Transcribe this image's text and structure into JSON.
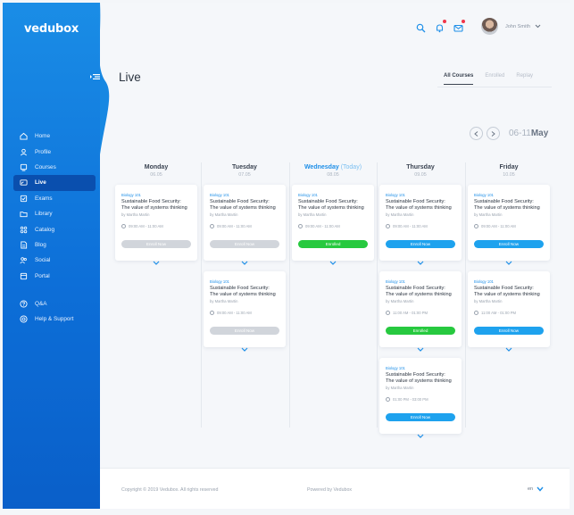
{
  "app": {
    "brand": "vedubox"
  },
  "sidebar": {
    "items": [
      {
        "label": "Home",
        "icon": "home-icon"
      },
      {
        "label": "Profile",
        "icon": "profile-icon"
      },
      {
        "label": "Courses",
        "icon": "courses-icon"
      },
      {
        "label": "Live",
        "icon": "live-icon",
        "active": true
      },
      {
        "label": "Exams",
        "icon": "exams-icon"
      },
      {
        "label": "Library",
        "icon": "library-icon"
      },
      {
        "label": "Catalog",
        "icon": "catalog-icon"
      },
      {
        "label": "Blog",
        "icon": "blog-icon"
      },
      {
        "label": "Social",
        "icon": "social-icon"
      },
      {
        "label": "Portal",
        "icon": "portal-icon"
      }
    ],
    "secondary": [
      {
        "label": "Q&A",
        "icon": "question-icon"
      },
      {
        "label": "Help & Support",
        "icon": "help-icon"
      }
    ]
  },
  "header": {
    "title": "Live",
    "user_name": "John Smith",
    "tabs": [
      "All Courses",
      "Enrolled",
      "Replay"
    ],
    "active_tab": "All Courses"
  },
  "week": {
    "range": "06-11",
    "month": "May"
  },
  "days": [
    {
      "name": "Monday",
      "date": "06.05",
      "today_label": ""
    },
    {
      "name": "Tuesday",
      "date": "07.05",
      "today_label": ""
    },
    {
      "name": "Wednesday",
      "date": "08.05",
      "today_label": "(Today)"
    },
    {
      "name": "Thursday",
      "date": "09.05",
      "today_label": ""
    },
    {
      "name": "Friday",
      "date": "10.05",
      "today_label": ""
    }
  ],
  "cards": [
    {
      "day": 0,
      "slot": 0,
      "tag": "Biology 101",
      "title_line1": "Sustainable Food Security:",
      "title_line2": "The value of systems thinking",
      "author": "by Martha Martin",
      "time": "09:00 AM - 11:00 AM",
      "button": "Enroll Now",
      "button_style": "gray"
    },
    {
      "day": 1,
      "slot": 0,
      "tag": "Biology 101",
      "title_line1": "Sustainable Food Security:",
      "title_line2": "The value of systems thinking",
      "author": "by Martha Martin",
      "time": "09:00 AM - 11:00 AM",
      "button": "Enroll Now",
      "button_style": "gray"
    },
    {
      "day": 1,
      "slot": 1,
      "tag": "Biology 101",
      "title_line1": "Sustainable Food Security:",
      "title_line2": "The value of systems thinking",
      "author": "by Martha Martin",
      "time": "09:00 AM - 11:00 AM",
      "button": "Enroll Now",
      "button_style": "gray"
    },
    {
      "day": 2,
      "slot": 0,
      "tag": "Biology 101",
      "title_line1": "Sustainable Food Security:",
      "title_line2": "The value of systems thinking",
      "author": "by Martha Martin",
      "time": "09:00 AM - 11:00 AM",
      "button": "Enrolled",
      "button_style": "green"
    },
    {
      "day": 3,
      "slot": 0,
      "tag": "Biology 101",
      "title_line1": "Sustainable Food Security:",
      "title_line2": "The value of systems thinking",
      "author": "by Martha Martin",
      "time": "09:00 AM - 11:00 AM",
      "button": "Enroll Now",
      "button_style": "blue"
    },
    {
      "day": 3,
      "slot": 1,
      "tag": "Biology 101",
      "title_line1": "Sustainable Food Security:",
      "title_line2": "The value of systems thinking",
      "author": "by Martha Martin",
      "time": "11:00 AM - 01:00 PM",
      "button": "Enrolled",
      "button_style": "green"
    },
    {
      "day": 3,
      "slot": 2,
      "tag": "Biology 101",
      "title_line1": "Sustainable Food Security:",
      "title_line2": "The value of systems thinking",
      "author": "by Martha Martin",
      "time": "01:00 PM - 03:00 PM",
      "button": "Enroll Now",
      "button_style": "blue"
    },
    {
      "day": 4,
      "slot": 0,
      "tag": "Biology 101",
      "title_line1": "Sustainable Food Security:",
      "title_line2": "The value of systems thinking",
      "author": "by Martha Martin",
      "time": "09:00 AM - 11:00 AM",
      "button": "Enroll Now",
      "button_style": "blue"
    },
    {
      "day": 4,
      "slot": 1,
      "tag": "Biology 101",
      "title_line1": "Sustainable Food Security:",
      "title_line2": "The value of systems thinking",
      "author": "by Martha Martin",
      "time": "11:00 AM - 01:00 PM",
      "button": "Enroll Now",
      "button_style": "blue"
    }
  ],
  "footer": {
    "copyright": "Copyright © 2019 Vedubox. All rights reserved",
    "powered": "Powered by Vedubox",
    "language": "en"
  },
  "colors": {
    "sidebar_top": "#1a8de6",
    "sidebar_bottom": "#0a5fc9",
    "accent": "#1e8fe8",
    "enroll_button": "#1ea2ee",
    "enrolled_button": "#27c93f",
    "disabled_button": "#d1d5db",
    "notification_dot": "#f0364b"
  }
}
